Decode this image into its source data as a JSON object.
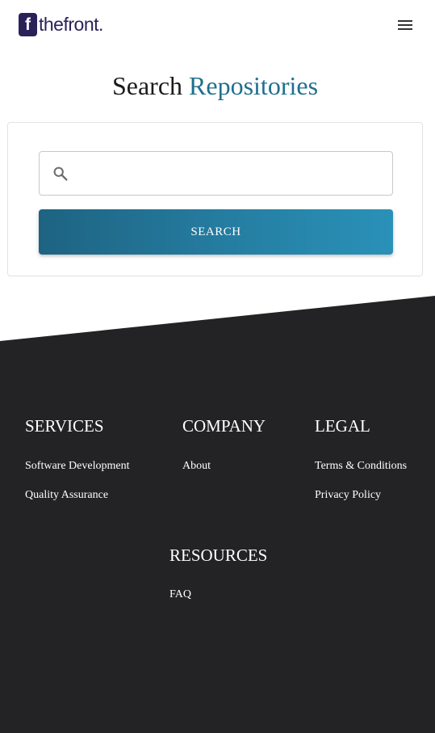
{
  "header": {
    "logo_mark": "f",
    "logo_text": "thefront",
    "logo_dot": ".",
    "menu_icon": "hamburger-menu-icon"
  },
  "hero": {
    "title_plain": "Search",
    "title_accent": "Repositories"
  },
  "search": {
    "value": "",
    "placeholder": "",
    "button_label": "SEARCH",
    "icon": "search-icon"
  },
  "colors": {
    "brand": "#2b2159",
    "accent": "#1f6f8e",
    "button_gradient_start": "#1e6382",
    "button_gradient_end": "#2a91b8",
    "footer_bg": "#232325"
  },
  "footer": {
    "columns": [
      {
        "title": "SERVICES",
        "links": [
          "Software Development",
          "Quality Assurance"
        ]
      },
      {
        "title": "COMPANY",
        "links": [
          "About"
        ]
      },
      {
        "title": "LEGAL",
        "links": [
          "Terms & Conditions",
          "Privacy Policy"
        ]
      },
      {
        "title": "RESOURCES",
        "links": [
          "FAQ"
        ]
      }
    ]
  }
}
